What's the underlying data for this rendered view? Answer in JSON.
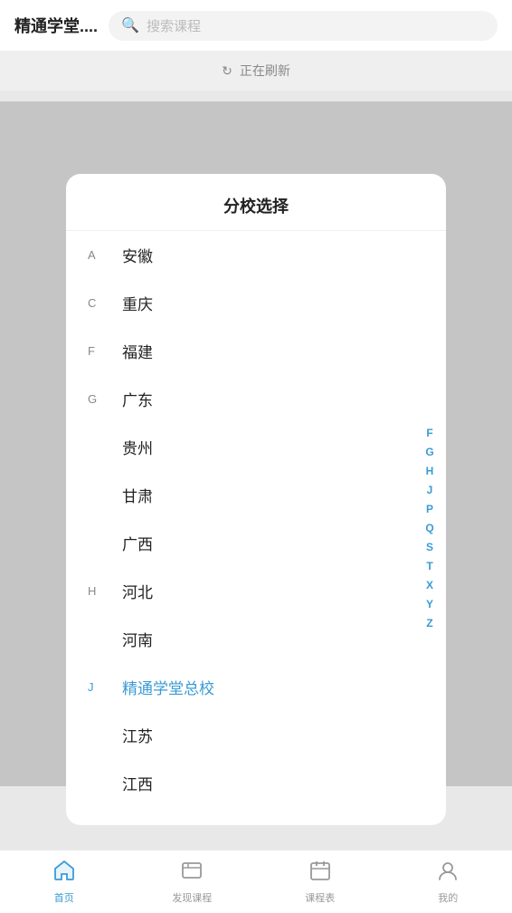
{
  "app": {
    "title": "精通学堂....",
    "search_placeholder": "搜索课程"
  },
  "refreshing": {
    "text": "正在刷新",
    "icon": "↻"
  },
  "modal": {
    "title": "分校选择"
  },
  "list": {
    "items": [
      {
        "letter": "A",
        "name": "安徽",
        "active": false
      },
      {
        "letter": "C",
        "name": "重庆",
        "active": false
      },
      {
        "letter": "F",
        "name": "福建",
        "active": false
      },
      {
        "letter": "G",
        "name": "广东",
        "active": false
      },
      {
        "letter": "",
        "name": "贵州",
        "active": false
      },
      {
        "letter": "",
        "name": "甘肃",
        "active": false
      },
      {
        "letter": "",
        "name": "广西",
        "active": false
      },
      {
        "letter": "H",
        "name": "河北",
        "active": false
      },
      {
        "letter": "",
        "name": "河南",
        "active": false
      },
      {
        "letter": "J",
        "name": "精通学堂总校",
        "active": true
      },
      {
        "letter": "",
        "name": "江苏",
        "active": false
      },
      {
        "letter": "",
        "name": "江西",
        "active": false
      }
    ],
    "side_index": [
      "F",
      "G",
      "H",
      "J",
      "P",
      "Q",
      "S",
      "T",
      "X",
      "Y",
      "Z"
    ]
  },
  "tabs": [
    {
      "id": "home",
      "label": "首页",
      "icon": "🏠",
      "active": true
    },
    {
      "id": "course",
      "label": "发现课程",
      "icon": "📋",
      "active": false
    },
    {
      "id": "schedule",
      "label": "课程表",
      "icon": "📅",
      "active": false
    },
    {
      "id": "mine",
      "label": "我的",
      "icon": "😊",
      "active": false
    }
  ]
}
